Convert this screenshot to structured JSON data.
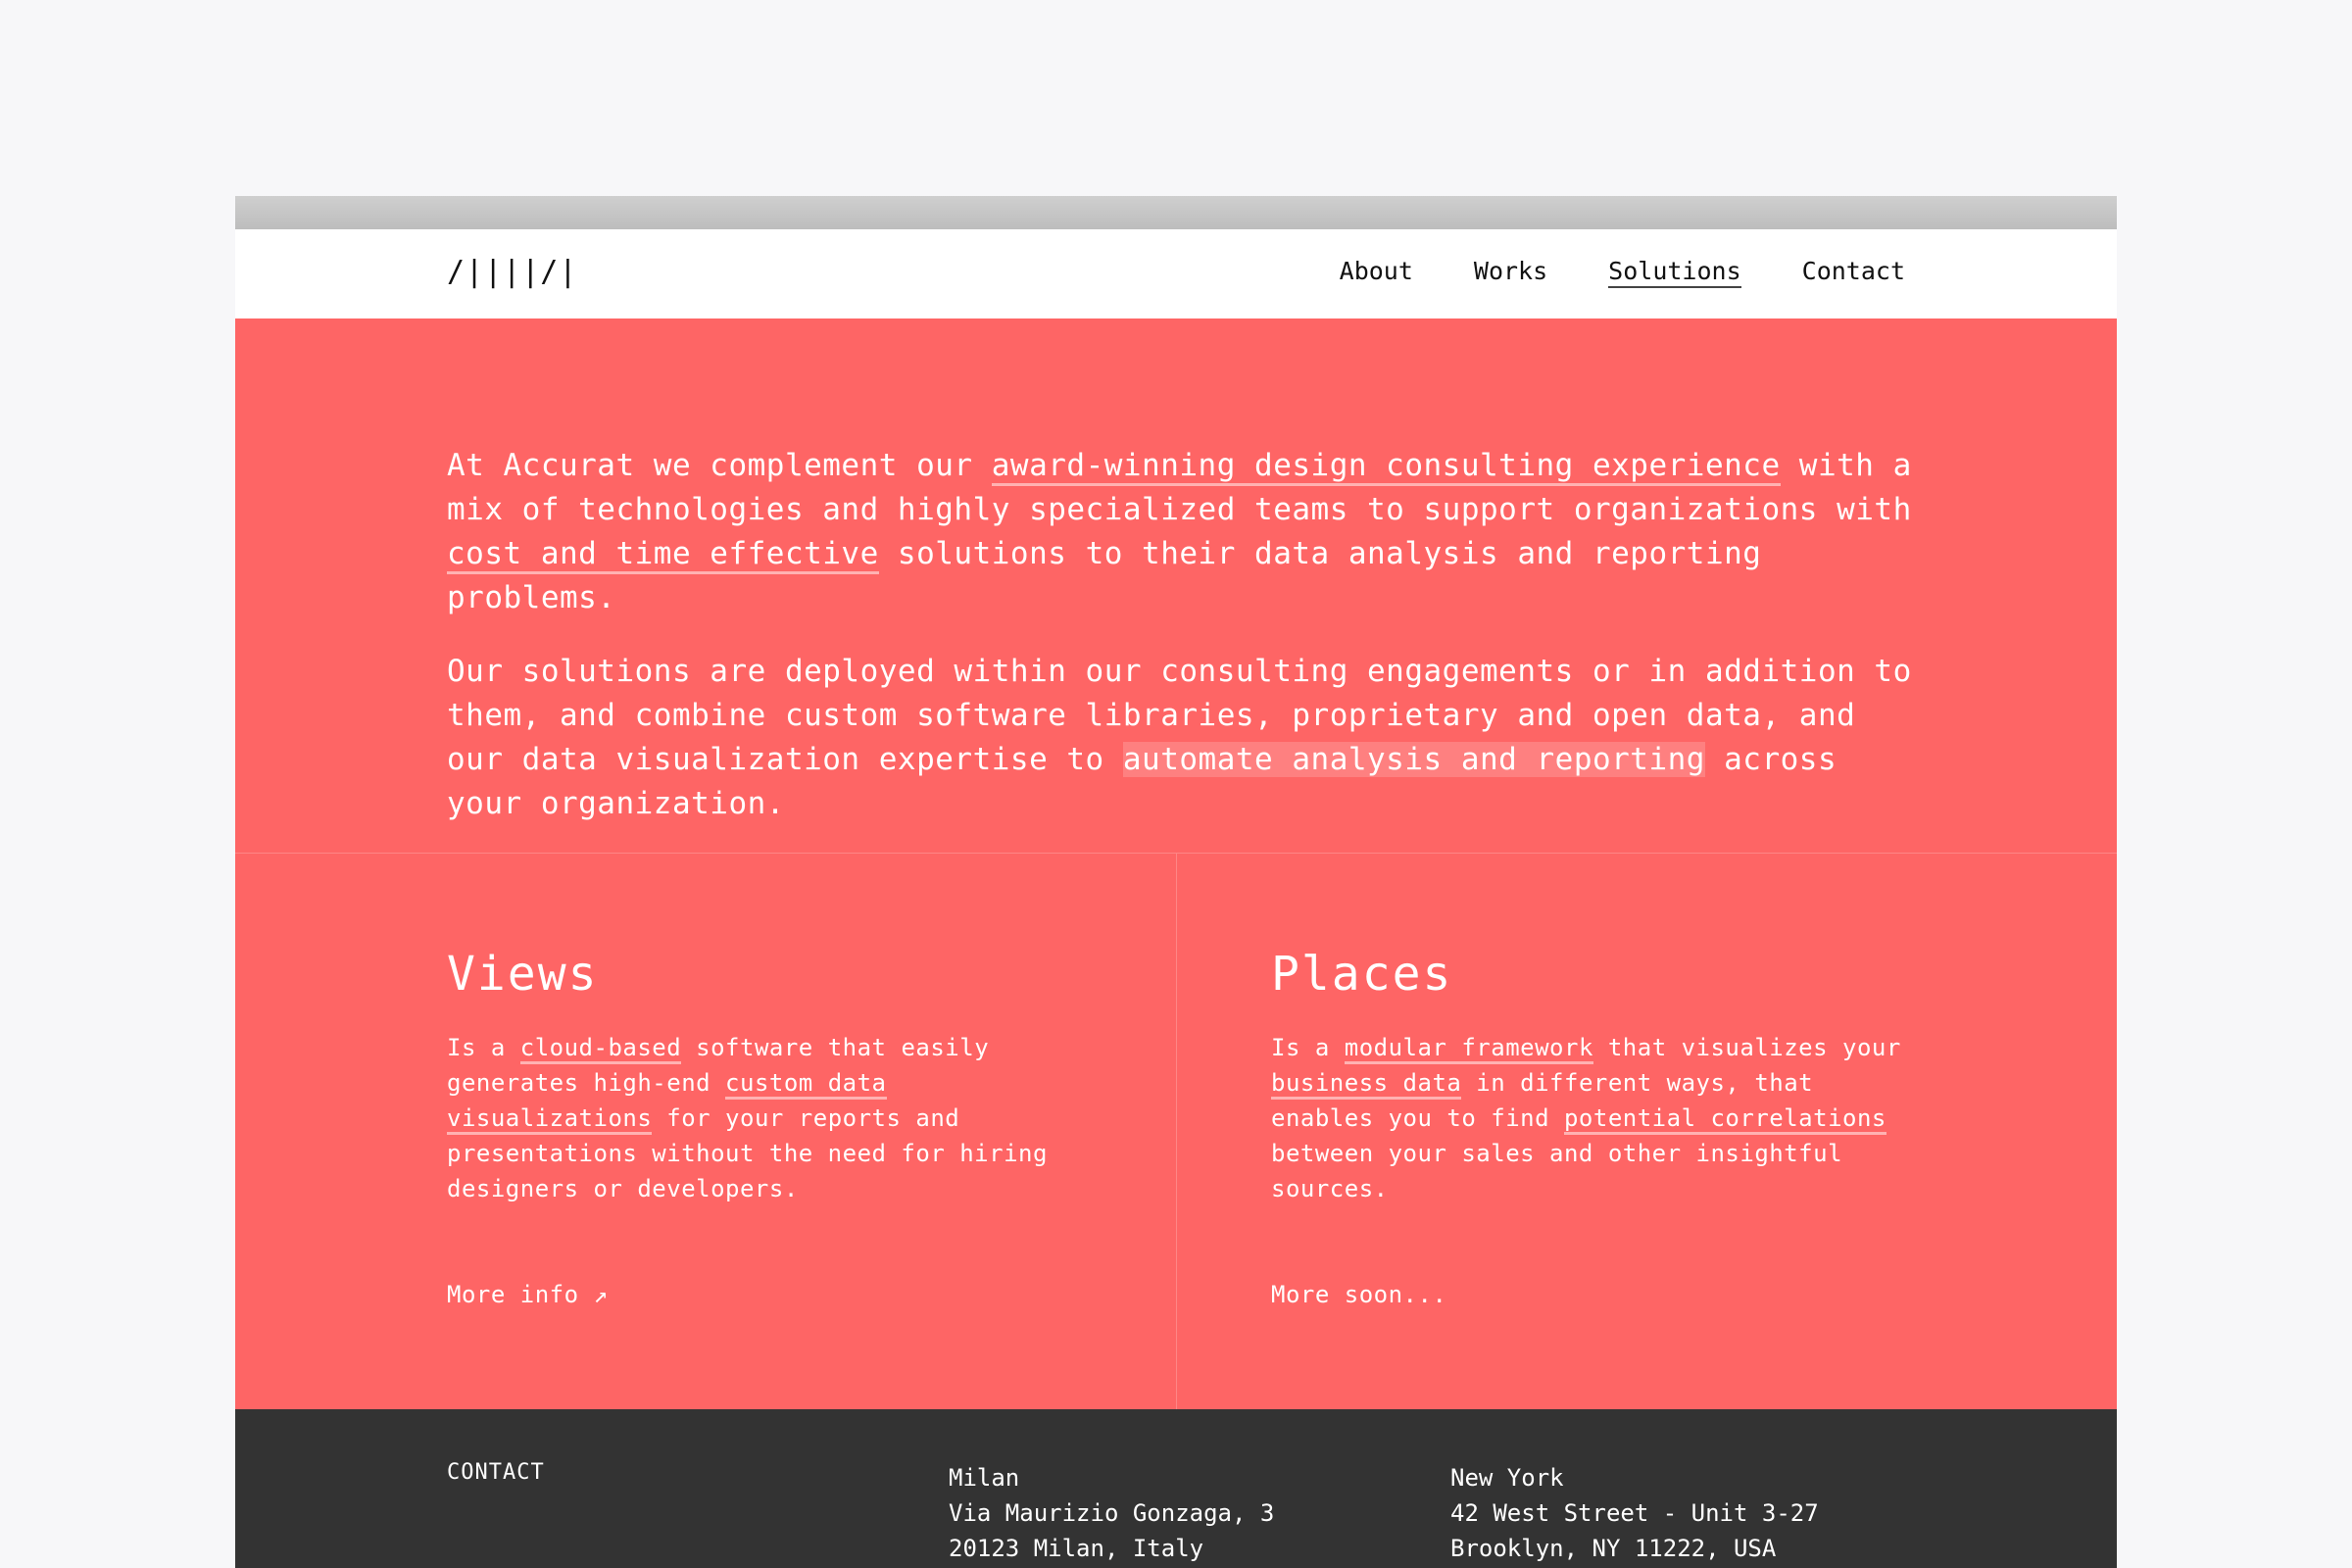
{
  "nav": {
    "logo": "/||||/|",
    "items": [
      "About",
      "Works",
      "Solutions",
      "Contact"
    ],
    "active": "Solutions"
  },
  "hero": {
    "p1_a": "At Accurat we complement our ",
    "p1_link1": "award-winning design consulting experience",
    "p1_b": " with a mix of technologies and highly specialized teams to support organizations with ",
    "p1_link2": "cost and time effective",
    "p1_c": " solutions to their data analysis and reporting problems.",
    "p2_a": "Our solutions are deployed within our consulting engagements or in addition to them, and combine custom software libraries, proprietary and open data, and our data visualization expertise to ",
    "p2_highlight": "automate analysis and reporting",
    "p2_b": " across your organization."
  },
  "views": {
    "title": "Views",
    "d1": "Is a ",
    "l1": "cloud-based",
    "d2": " software that easily generates high-end ",
    "l2": "custom data visualizations",
    "d3": " for your reports and presentations without the need for hiring designers or developers.",
    "link": "More info ↗"
  },
  "places": {
    "title": "Places",
    "d1": "Is a ",
    "l1": "modular framework",
    "d2": " that visualizes your ",
    "l2": "business data",
    "d3": " in different ways, that enables you to find ",
    "l3": "potential correlations",
    "d4": " between your sales and other insightful sources.",
    "link": "More soon..."
  },
  "footer": {
    "label": "CONTACT",
    "milan": [
      "Milan",
      "Via Maurizio Gonzaga, 3",
      "20123 Milan, Italy"
    ],
    "newyork": [
      "New York",
      "42 West Street - Unit 3-27",
      "Brooklyn, NY 11222, USA"
    ]
  },
  "colors": {
    "accent": "#fe6565",
    "footer": "#333333",
    "page": "#f7f7f9"
  }
}
